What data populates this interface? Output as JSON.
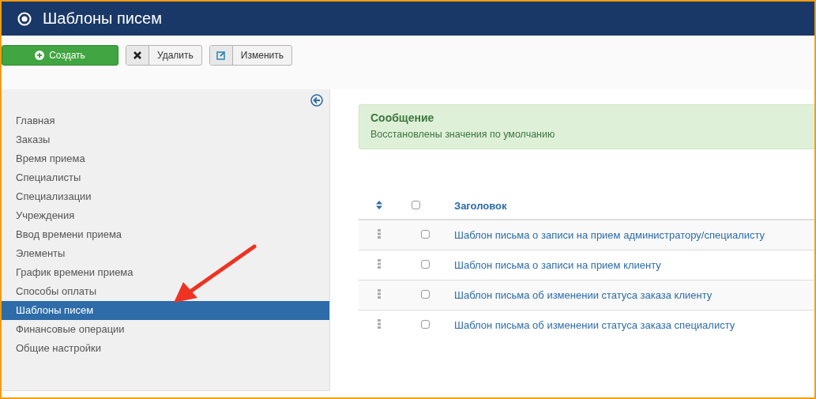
{
  "header": {
    "title": "Шаблоны писем"
  },
  "toolbar": [
    {
      "kind": "primary",
      "label": "Создать"
    },
    {
      "kind": "delete",
      "label": "Удалить"
    },
    {
      "kind": "edit",
      "label": "Изменить"
    }
  ],
  "sidebar": {
    "items": [
      {
        "label": "Главная",
        "selected": false
      },
      {
        "label": "Заказы",
        "selected": false
      },
      {
        "label": "Время приема",
        "selected": false
      },
      {
        "label": "Специалисты",
        "selected": false
      },
      {
        "label": "Специализации",
        "selected": false
      },
      {
        "label": "Учреждения",
        "selected": false
      },
      {
        "label": "Ввод времени приема",
        "selected": false
      },
      {
        "label": "Элементы",
        "selected": false
      },
      {
        "label": "График времени приема",
        "selected": false
      },
      {
        "label": "Способы оплаты",
        "selected": false
      },
      {
        "label": "Шаблоны писем",
        "selected": true
      },
      {
        "label": "Финансовые операции",
        "selected": false
      },
      {
        "label": "Общие настройки",
        "selected": false
      }
    ]
  },
  "message": {
    "title": "Сообщение",
    "text": "Восстановлены значения по умолчанию"
  },
  "table": {
    "header": {
      "title": "Заголовок",
      "checked": false
    },
    "rows": [
      {
        "title": "Шаблон письма о записи на прием администратору/специалисту",
        "checked": false
      },
      {
        "title": "Шаблон письма о записи на прием клиенту",
        "checked": false
      },
      {
        "title": "Шаблон письма об изменении статуса заказа клиенту",
        "checked": false
      },
      {
        "title": "Шаблон письма об изменении статуса заказа специалисту",
        "checked": false
      }
    ]
  }
}
